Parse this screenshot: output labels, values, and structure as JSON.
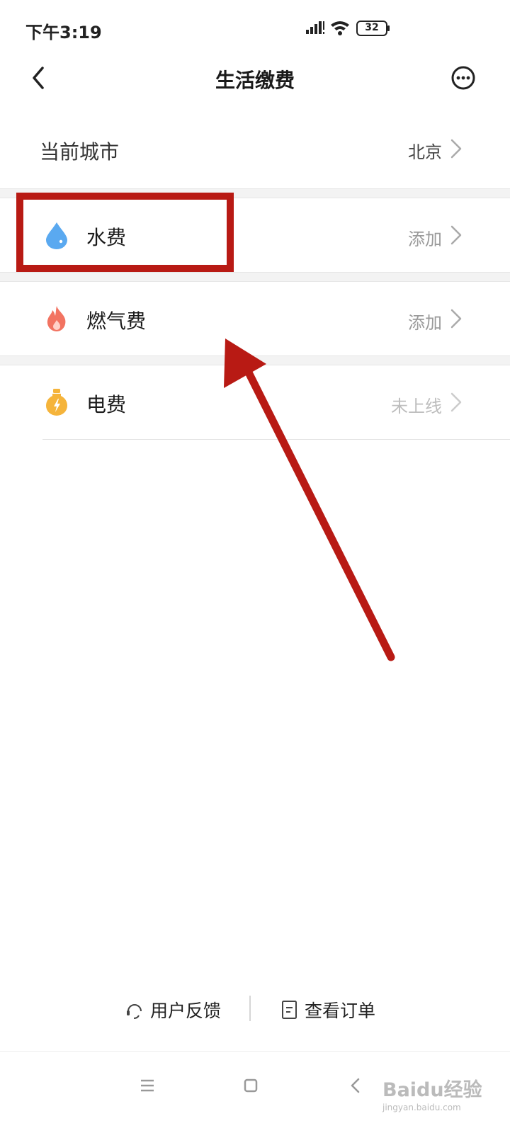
{
  "status_bar": {
    "time": "下午3:19",
    "battery": "32"
  },
  "header": {
    "title": "生活缴费",
    "back_icon": "chevron-left-icon",
    "more_icon": "more-circle-icon"
  },
  "city": {
    "label": "当前城市",
    "value": "北京"
  },
  "bills": [
    {
      "label": "水费",
      "action": "添加",
      "icon": "water-drop-icon",
      "color": "#5aa9f0"
    },
    {
      "label": "燃气费",
      "action": "添加",
      "icon": "flame-icon",
      "color": "#f27361"
    },
    {
      "label": "电费",
      "action": "未上线",
      "icon": "lightbulb-icon",
      "color": "#f5b43b"
    }
  ],
  "bottom_links": {
    "feedback": "用户反馈",
    "orders": "查看订单"
  },
  "watermark": {
    "brand": "Baidu经验",
    "url": "jingyan.baidu.com"
  },
  "annotation_color": "#b81a14"
}
